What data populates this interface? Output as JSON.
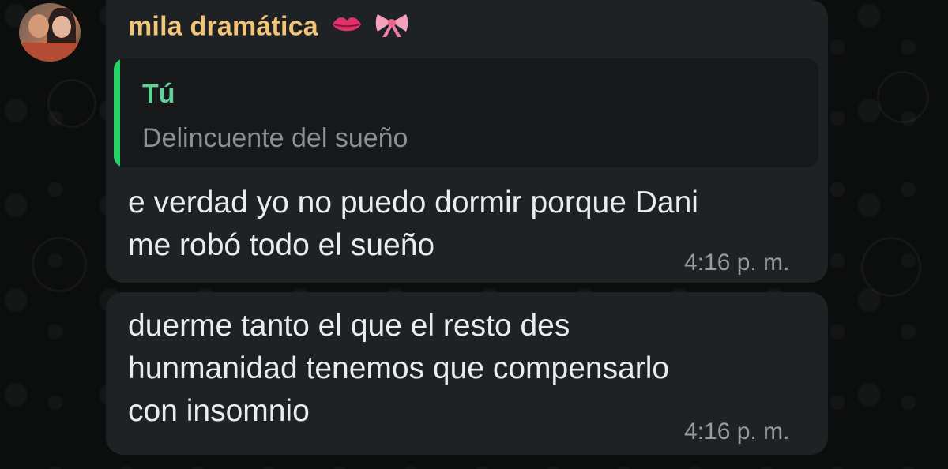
{
  "chat": {
    "sender_name": "mila dramática",
    "sender_emojis": [
      "kiss-mark-icon",
      "ribbon-icon"
    ],
    "messages": [
      {
        "reply": {
          "author": "Tú",
          "text": "Delincuente del sueño"
        },
        "text": "e verdad yo no puedo dormir porque Dani\nme robó todo el sueño",
        "time": "4:16 p. m."
      },
      {
        "text": "duerme tanto el que el resto des\nhunmanidad tenemos que compensarlo\ncon insomnio",
        "time": "4:16 p. m."
      }
    ]
  },
  "colors": {
    "bubble": "#1f2225",
    "sender_name": "#f3c577",
    "reply_author": "#61d198",
    "reply_bar": "#25d366",
    "text": "#e9edef",
    "timestamp": "#959ca1"
  }
}
